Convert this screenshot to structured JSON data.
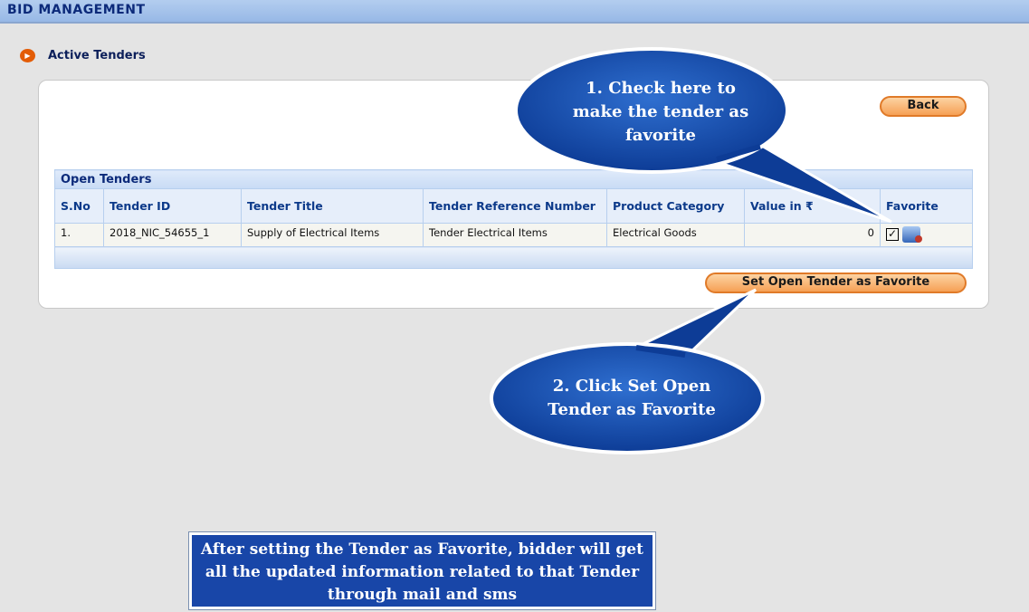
{
  "header": {
    "title": "BID MANAGEMENT"
  },
  "section": {
    "title": "Active Tenders",
    "icon": "play-circle-icon"
  },
  "buttons": {
    "back": "Back",
    "set_favorite": "Set Open Tender as Favorite"
  },
  "table": {
    "caption": "Open Tenders",
    "columns": [
      "S.No",
      "Tender ID",
      "Tender Title",
      "Tender Reference Number",
      "Product Category",
      "Value in ₹",
      "Favorite"
    ],
    "rows": [
      {
        "sno": "1.",
        "tender_id": "2018_NIC_54655_1",
        "title": "Supply of Electrical Items",
        "ref": "Tender Electrical Items",
        "category": "Electrical Goods",
        "value": "0",
        "favorite_checked": true,
        "view_icon": "view-document-icon"
      }
    ]
  },
  "callouts": {
    "step1": "1. Check here to make the tender as favorite",
    "step2": "2. Click  Set Open Tender as Favorite",
    "note": "After setting the Tender as Favorite, bidder will get all the updated information related to that Tender through mail and sms"
  },
  "colors": {
    "accent": "#1846a8",
    "button": "#f6a055",
    "header": "#a9c6ec"
  }
}
